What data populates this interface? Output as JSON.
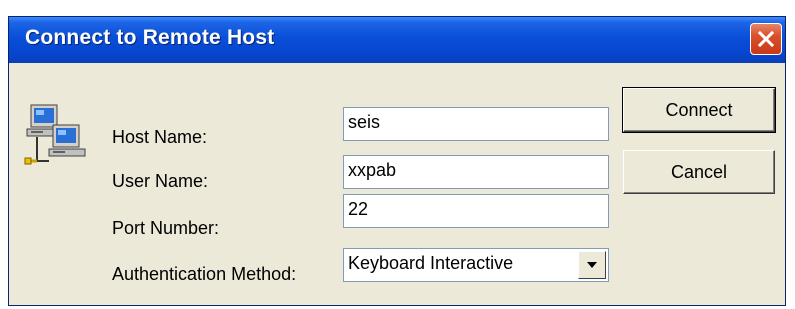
{
  "window": {
    "title": "Connect to Remote Host"
  },
  "form": {
    "host_name_label": "Host Name:",
    "host_name_value": "seis",
    "user_name_label": "User Name:",
    "user_name_value": "xxpab",
    "port_number_label": "Port Number:",
    "port_number_value": "22",
    "auth_method_label": "Authentication Method:",
    "auth_method_value": "Keyboard Interactive"
  },
  "buttons": {
    "connect_label": "Connect",
    "cancel_label": "Cancel"
  },
  "icons": {
    "app": "networked-computers-icon",
    "close": "close-icon",
    "dropdown": "chevron-down-icon"
  },
  "colors": {
    "titlebar": "#0a4fd8",
    "close_button": "#d8502c",
    "dialog_background": "#ece9d8"
  }
}
